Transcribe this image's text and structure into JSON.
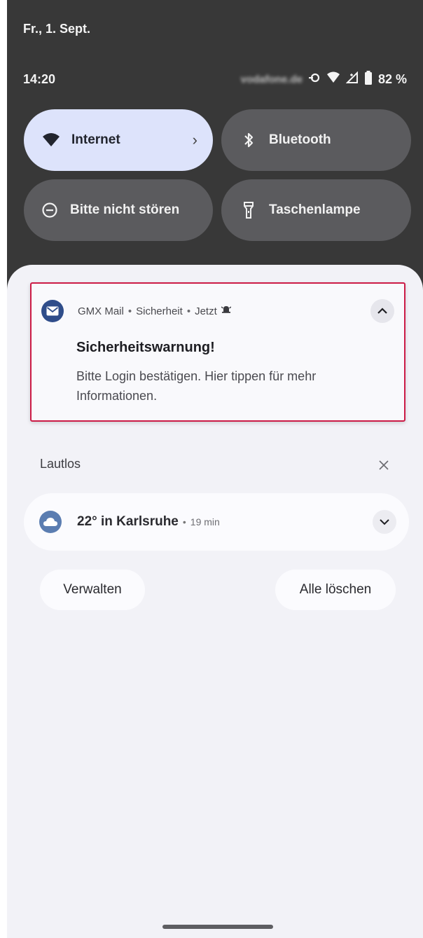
{
  "status_bar": {
    "date": "Fr., 1. Sept.",
    "time": "14:20",
    "carrier": "vodafone.de",
    "battery": "82 %"
  },
  "quick_settings": {
    "internet": "Internet",
    "bluetooth": "Bluetooth",
    "dnd": "Bitte nicht stören",
    "flashlight": "Taschenlampe"
  },
  "notification": {
    "app": "GMX Mail",
    "channel": "Sicherheit",
    "time": "Jetzt",
    "title": "Sicherheitswarnung!",
    "body": "Bitte Login bestätigen. Hier tippen für mehr Informationen."
  },
  "silent_section": {
    "title": "Lautlos",
    "weather_title": "22° in Karlsruhe",
    "weather_time": "19 min"
  },
  "actions": {
    "manage": "Verwalten",
    "clear_all": "Alle löschen"
  },
  "colors": {
    "shade_bg": "#383838",
    "tile_active": "#dde3fb",
    "tile_inactive": "#5b5b5e",
    "highlight_border": "#cc1b46",
    "app_icon": "#2f4d8a"
  },
  "icons": {
    "wifi": "wifi-icon",
    "bluetooth": "bluetooth-icon",
    "dnd": "do-not-disturb-icon",
    "flashlight": "flashlight-icon",
    "mail": "mail-icon",
    "cloud": "cloud-icon"
  }
}
